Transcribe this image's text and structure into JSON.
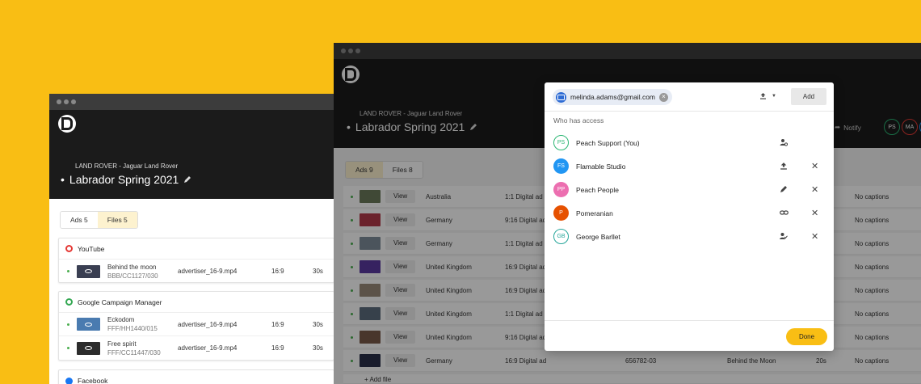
{
  "left_window": {
    "breadcrumb": "LAND ROVER - Jaguar Land Rover",
    "title": "Labrador Spring 2021",
    "tabs": [
      {
        "label": "Ads 5",
        "active": false
      },
      {
        "label": "Files 5",
        "active": true
      }
    ],
    "groups": [
      {
        "name": "YouTube",
        "icon": "youtube-icon",
        "icon_color": "#e53935",
        "files": [
          {
            "title": "Behind the moon",
            "code": "BBB/CC1127/030",
            "file": "advertiser_16-9.mp4",
            "ratio": "16:9",
            "duration": "30s"
          }
        ]
      },
      {
        "name": "Google Campaign Manager",
        "icon": "google-campaign-manager-icon",
        "icon_color": "#34a853",
        "files": [
          {
            "title": "Eckodom",
            "code": "FFF/HH1440/015",
            "file": "advertiser_16-9.mp4",
            "ratio": "16:9",
            "duration": "30s"
          },
          {
            "title": "Free spirit",
            "code": "FFF/CC11447/030",
            "file": "advertiser_16-9.mp4",
            "ratio": "16:9",
            "duration": "30s"
          }
        ]
      },
      {
        "name": "Facebook",
        "icon": "facebook-icon",
        "icon_color": "#1877f2",
        "files": []
      }
    ]
  },
  "right_window": {
    "breadcrumb": "LAND ROVER - Jaguar Land Rover",
    "title": "Labrador Spring 2021",
    "notify_label": "Notify",
    "avatars": [
      {
        "initials": "PS",
        "color": "#2bb673"
      },
      {
        "initials": "MA",
        "color": "#e53935"
      },
      {
        "initials": "FS",
        "color": "#2196f3"
      }
    ],
    "tabs": [
      {
        "label": "Ads 9",
        "active": true
      },
      {
        "label": "Files 8",
        "active": false
      }
    ],
    "view_label": "View",
    "add_file_label": "+ Add file",
    "rows": [
      {
        "country": "Australia",
        "ad": "1:1 Digital ad",
        "clock": "",
        "title": "",
        "duration": "",
        "captions": "No captions",
        "thumb": "#6b7a5a"
      },
      {
        "country": "Germany",
        "ad": "9:16 Digital ad",
        "clock": "",
        "title": "",
        "duration": "",
        "captions": "No captions",
        "thumb": "#b33a4a"
      },
      {
        "country": "Germany",
        "ad": "1:1 Digital ad",
        "clock": "",
        "title": "",
        "duration": "",
        "captions": "No captions",
        "thumb": "#7e8c9a"
      },
      {
        "country": "United Kingdom",
        "ad": "16:9 Digital ad",
        "clock": "",
        "title": "",
        "duration": "",
        "captions": "No captions",
        "thumb": "#5b3aa0"
      },
      {
        "country": "United Kingdom",
        "ad": "16:9 Digital ad",
        "clock": "",
        "title": "",
        "duration": "",
        "captions": "No captions",
        "thumb": "#9a8a7a"
      },
      {
        "country": "United Kingdom",
        "ad": "1:1 Digital ad",
        "clock": "",
        "title": "",
        "duration": "",
        "captions": "No captions",
        "thumb": "#5d6d7e"
      },
      {
        "country": "United Kingdom",
        "ad": "9:16 Digital ad",
        "clock": "",
        "title": "",
        "duration": "",
        "captions": "No captions",
        "thumb": "#7a5a4a"
      },
      {
        "country": "Germany",
        "ad": "16:9 Digital ad",
        "clock": "656782-03",
        "title": "Behind the Moon",
        "duration": "20s",
        "captions": "No captions",
        "thumb": "#2a2f4a"
      }
    ]
  },
  "share_modal": {
    "email_chip": "melinda.adams@gmail.com",
    "add_label": "Add",
    "who_has_access": "Who has access",
    "done_label": "Done",
    "people": [
      {
        "initials": "PS",
        "name": "Peach Support (You)",
        "color": "#2bb673",
        "outline": true,
        "role_icon": "manage-access-icon",
        "removable": false
      },
      {
        "initials": "FS",
        "name": "Flamable Studio",
        "color": "#2196f3",
        "outline": false,
        "role_icon": "upload-icon",
        "removable": true
      },
      {
        "initials": "PP",
        "name": "Peach People",
        "color": "#ec6fb0",
        "outline": false,
        "role_icon": "edit-icon",
        "removable": true
      },
      {
        "initials": "P",
        "name": "Pomeranian",
        "color": "#e65100",
        "outline": false,
        "role_icon": "link-icon",
        "removable": true
      },
      {
        "initials": "GB",
        "name": "George Barllet",
        "color": "#26a69a",
        "outline": true,
        "role_icon": "approve-icon",
        "removable": true
      }
    ]
  }
}
